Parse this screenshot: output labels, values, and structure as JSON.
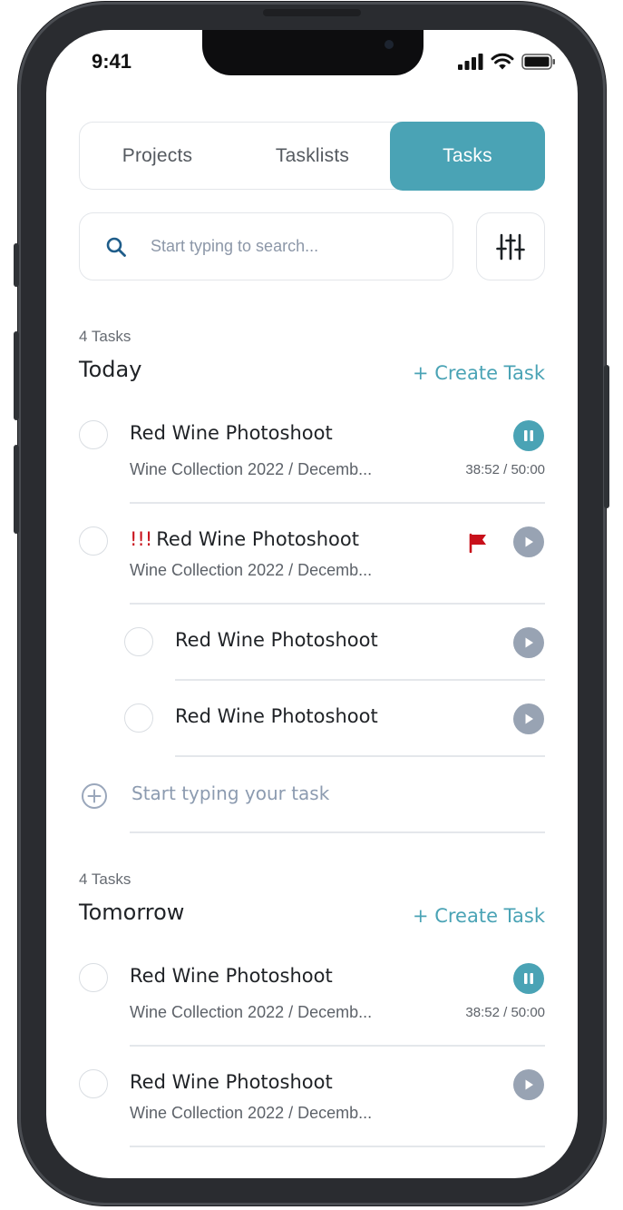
{
  "status_bar": {
    "time": "9:41"
  },
  "tabs": [
    {
      "label": "Projects",
      "active": false
    },
    {
      "label": "Tasklists",
      "active": false
    },
    {
      "label": "Tasks",
      "active": true
    }
  ],
  "search": {
    "placeholder": "Start typing to search...",
    "value": ""
  },
  "colors": {
    "accent": "#4aa3b5",
    "play": "#98a3b3",
    "priority": "#c8101a"
  },
  "sections": [
    {
      "count": "4 Tasks",
      "title": "Today",
      "create_label": "+ Create Task",
      "tasks": [
        {
          "title": "Red Wine Photoshoot",
          "subtitle": "Wine Collection 2022 / Decemb...",
          "timer": "38:52 / 50:00",
          "state": "pause-icon"
        },
        {
          "priority": "!!!",
          "title": "Red Wine Photoshoot",
          "subtitle": "Wine Collection 2022 / Decemb...",
          "flagged": true,
          "state": "play-icon"
        },
        {
          "title": "Red Wine Photoshoot",
          "subtask": true,
          "state": "play-icon"
        },
        {
          "title": "Red Wine Photoshoot",
          "subtask": true,
          "state": "play-icon"
        }
      ],
      "new_task_placeholder": "Start typing your task"
    },
    {
      "count": "4 Tasks",
      "title": "Tomorrow",
      "create_label": "+ Create Task",
      "tasks": [
        {
          "title": "Red Wine Photoshoot",
          "subtitle": "Wine Collection 2022 / Decemb...",
          "timer": "38:52 / 50:00",
          "state": "pause-icon"
        },
        {
          "title": "Red Wine Photoshoot",
          "subtitle": "Wine Collection 2022 / Decemb...",
          "state": "play-icon"
        }
      ]
    }
  ]
}
